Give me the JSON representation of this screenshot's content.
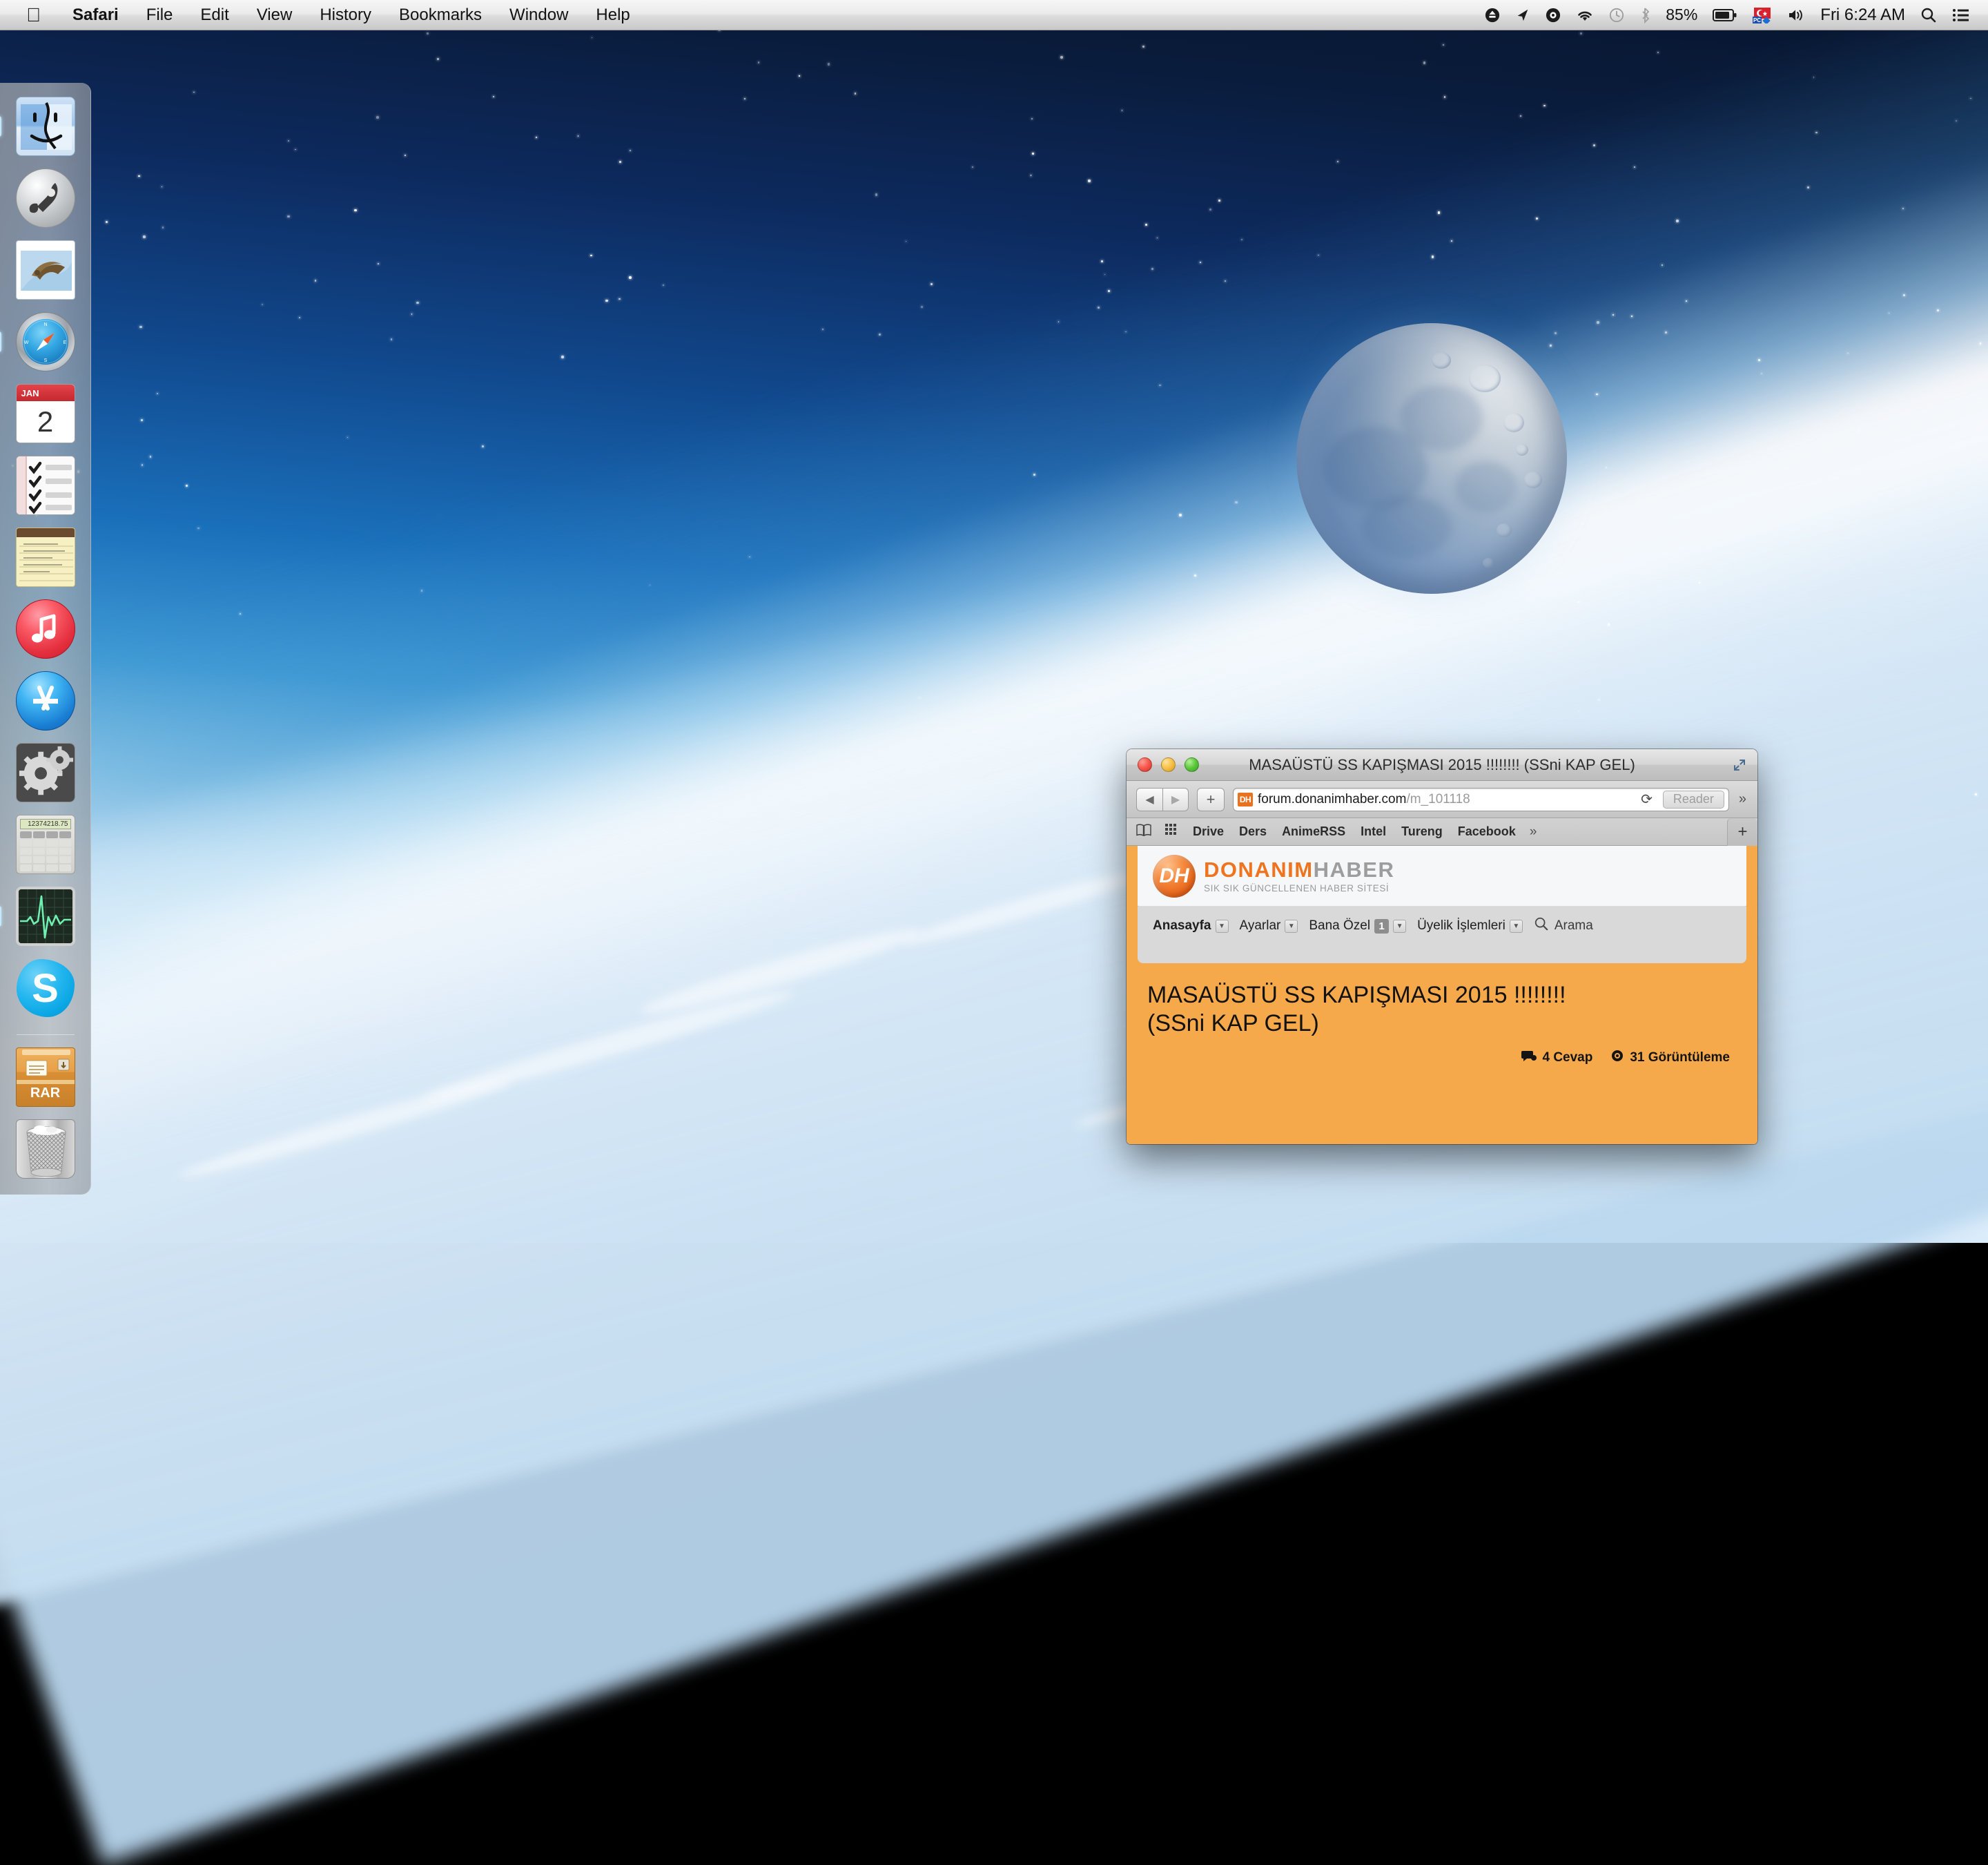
{
  "menubar": {
    "apple_icon": "apple-logo-icon",
    "items": [
      {
        "label": "Safari",
        "bold": true
      },
      {
        "label": "File",
        "bold": false
      },
      {
        "label": "Edit",
        "bold": false
      },
      {
        "label": "View",
        "bold": false
      },
      {
        "label": "History",
        "bold": false
      },
      {
        "label": "Bookmarks",
        "bold": false
      },
      {
        "label": "Window",
        "bold": false
      },
      {
        "label": "Help",
        "bold": false
      }
    ],
    "status": {
      "dropbox_icon": "dropbox-icon",
      "cloud_icon": "arrow-share-icon",
      "vpn_icon": "at-circle-icon",
      "wifi_icon": "wifi-icon",
      "timemachine_icon": "time-machine-icon",
      "bluetooth_icon": "bluetooth-icon",
      "battery_percent": "85%",
      "battery_icon": "battery-icon",
      "input_flag": "turkish-flag-pc-icon",
      "volume_icon": "volume-icon",
      "clock": "Fri 6:24 AM",
      "spotlight_icon": "search-icon",
      "notification_icon": "notification-center-icon"
    }
  },
  "dock": {
    "items": [
      {
        "name": "finder",
        "label": "Finder",
        "running": true
      },
      {
        "name": "launchpad",
        "label": "Launchpad",
        "running": false
      },
      {
        "name": "mail",
        "label": "Mail",
        "running": false
      },
      {
        "name": "safari",
        "label": "Safari",
        "running": true
      },
      {
        "name": "calendar",
        "label": "Calendar",
        "running": false,
        "month": "JAN",
        "day": "2"
      },
      {
        "name": "reminders",
        "label": "Reminders",
        "running": false
      },
      {
        "name": "notes",
        "label": "Notes",
        "running": false
      },
      {
        "name": "itunes",
        "label": "iTunes",
        "running": false
      },
      {
        "name": "app-store",
        "label": "App Store",
        "running": false
      },
      {
        "name": "system-preferences",
        "label": "System Preferences",
        "running": false
      },
      {
        "name": "calculator",
        "label": "Calculator",
        "running": false,
        "display": "12374218.75"
      },
      {
        "name": "activity-monitor",
        "label": "Activity Monitor",
        "running": true
      },
      {
        "name": "skype",
        "label": "Skype",
        "running": false,
        "glyph": "S"
      }
    ],
    "stack": {
      "name": "rar-archive",
      "label": "RAR"
    },
    "trash": {
      "name": "trash",
      "label": "Trash"
    }
  },
  "safari": {
    "window_title": "MASAÜSTÜ SS KAPIŞMASI 2015 !!!!!!!! (SSni KAP GEL)",
    "traffic_lights": {
      "close": "close-button",
      "minimize": "minimize-button",
      "zoom": "zoom-button"
    },
    "fullscreen_icon": "fullscreen-icon",
    "toolbar": {
      "back_icon": "back-arrow-icon",
      "forward_icon": "forward-arrow-icon",
      "add_bookmark_icon": "plus-icon",
      "favicon_text": "DH",
      "url_host": "forum.donanimhaber.com",
      "url_path": "/m_101118",
      "reload_icon": "reload-icon",
      "reader_label": "Reader",
      "overflow_icon": "chevron-double-right-icon"
    },
    "bookmarks_bar": {
      "sidebar_icon": "book-sidebar-icon",
      "topsites_icon": "grid-top-sites-icon",
      "items": [
        "Drive",
        "Ders",
        "AnimeRSS",
        "Intel",
        "Tureng",
        "Facebook"
      ],
      "overflow_icon": "chevron-double-right-icon",
      "newtab_label": "+"
    },
    "page": {
      "logo": {
        "badge": "DH",
        "word1": "DONANIM",
        "word2": "HABER",
        "tagline": "SIK SIK GÜNCELLENEN HABER SİTESİ"
      },
      "nav": [
        {
          "label": "Anasayfa",
          "active": true,
          "caret": true,
          "badge": null
        },
        {
          "label": "Ayarlar",
          "active": false,
          "caret": true,
          "badge": null
        },
        {
          "label": "Bana Özel",
          "active": false,
          "caret": true,
          "badge": "1"
        },
        {
          "label": "Üyelik İşlemleri",
          "active": false,
          "caret": true,
          "badge": null
        }
      ],
      "search_label": "Arama",
      "search_icon": "search-icon",
      "thread": {
        "title_line1": "MASAÜSTÜ SS KAPIŞMASI 2015 !!!!!!!!",
        "title_line2": "(SSni KAP GEL)",
        "replies": "4 Cevap",
        "replies_icon": "comment-icon",
        "views": "31 Görüntüleme",
        "views_icon": "eye-icon"
      }
    }
  },
  "colors": {
    "page_accent": "#f6a94a",
    "brand_orange": "#ee7420",
    "brand_gray": "#9d9d9d",
    "nav_bg": "#d9d9d9"
  }
}
